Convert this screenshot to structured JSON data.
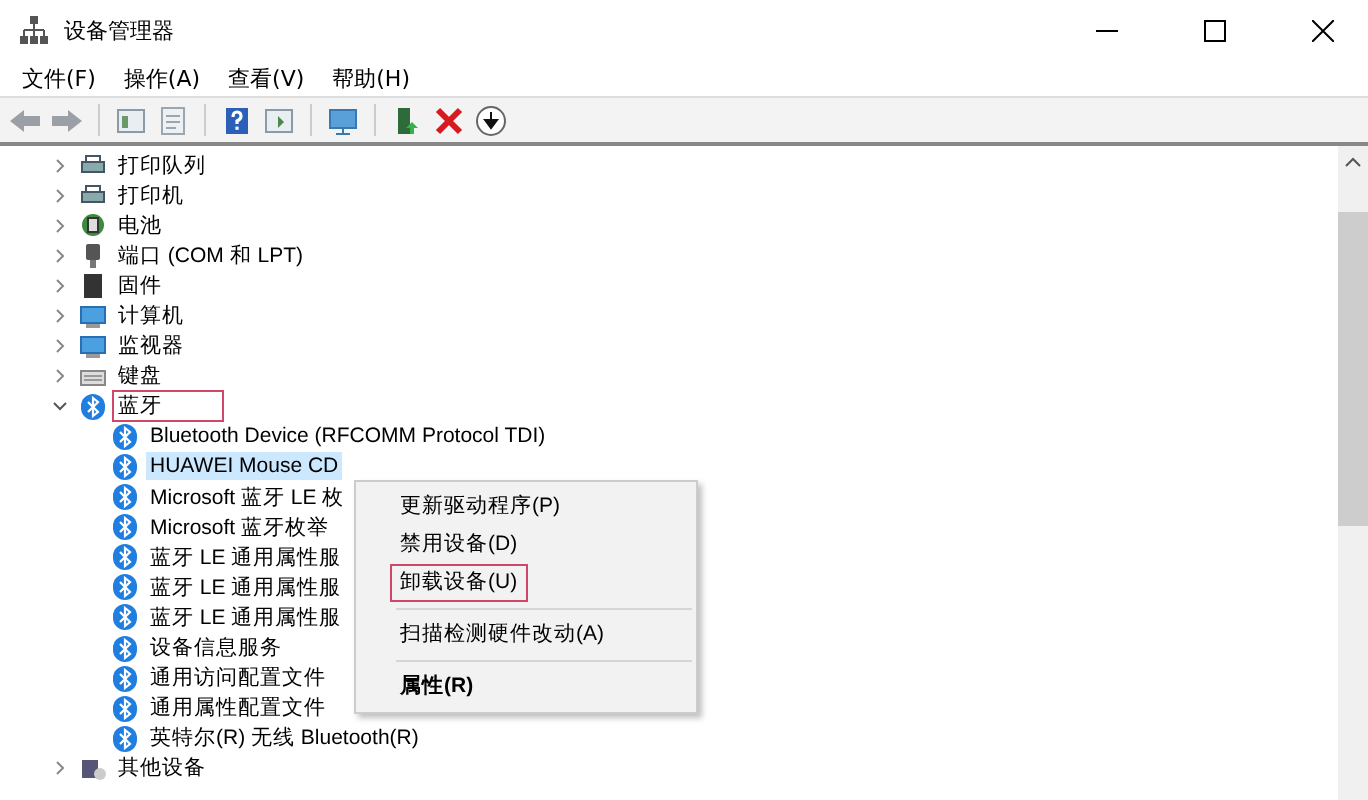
{
  "window": {
    "title": "设备管理器"
  },
  "menu_bar": [
    "文件(F)",
    "操作(A)",
    "查看(V)",
    "帮助(H)"
  ],
  "tree": [
    {
      "label": "打印队列",
      "expanded": false,
      "highlighted": false
    },
    {
      "label": "打印机",
      "expanded": false,
      "highlighted": false
    },
    {
      "label": "电池",
      "expanded": false,
      "highlighted": false
    },
    {
      "label": "端口 (COM 和 LPT)",
      "expanded": false,
      "highlighted": false
    },
    {
      "label": "固件",
      "expanded": false,
      "highlighted": false
    },
    {
      "label": "计算机",
      "expanded": false,
      "highlighted": false
    },
    {
      "label": "监视器",
      "expanded": false,
      "highlighted": false
    },
    {
      "label": "键盘",
      "expanded": false,
      "highlighted": false
    },
    {
      "label": "蓝牙",
      "expanded": true,
      "highlighted": true,
      "children": [
        {
          "label": "Bluetooth Device (RFCOMM Protocol TDI)",
          "selected": false
        },
        {
          "label": "HUAWEI Mouse CD",
          "selected": true
        },
        {
          "label": "Microsoft 蓝牙 LE 枚",
          "selected": false
        },
        {
          "label": "Microsoft 蓝牙枚举",
          "selected": false
        },
        {
          "label": "蓝牙 LE 通用属性服",
          "selected": false
        },
        {
          "label": "蓝牙 LE 通用属性服",
          "selected": false
        },
        {
          "label": "蓝牙 LE 通用属性服",
          "selected": false
        },
        {
          "label": "设备信息服务",
          "selected": false
        },
        {
          "label": "通用访问配置文件",
          "selected": false
        },
        {
          "label": "通用属性配置文件",
          "selected": false
        },
        {
          "label": "英特尔(R) 无线 Bluetooth(R)",
          "selected": false
        }
      ]
    },
    {
      "label": "其他设备",
      "expanded": false,
      "highlighted": false
    }
  ],
  "context_menu": [
    {
      "kind": "item",
      "label": "更新驱动程序(P)",
      "highlighted": false
    },
    {
      "kind": "item",
      "label": "禁用设备(D)",
      "highlighted": false
    },
    {
      "kind": "item",
      "label": "卸载设备(U)",
      "highlighted": true
    },
    {
      "kind": "separator"
    },
    {
      "kind": "item",
      "label": "扫描检测硬件改动(A)",
      "highlighted": false
    },
    {
      "kind": "separator"
    },
    {
      "kind": "default",
      "label": "属性(R)",
      "highlighted": false
    }
  ]
}
